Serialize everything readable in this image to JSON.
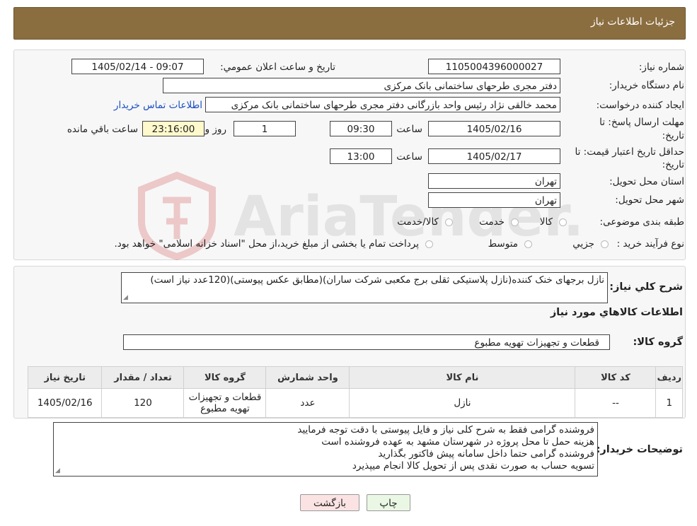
{
  "header": {
    "title": "جزئیات اطلاعات نیاز"
  },
  "labels": {
    "need_number": "شماره نیاز:",
    "announce_datetime": "تاریخ و ساعت اعلان عمومي:",
    "buyer_org": "نام دستگاه خریدار:",
    "requester": "ایجاد کننده درخواست:",
    "send_deadline_1": "مهلت ارسال پاسخ: تا",
    "send_deadline_2": "تاریخ:",
    "time_word": "ساعت",
    "day_and": "روز و",
    "remaining": "ساعت باقي مانده",
    "price_validity_1": "حداقل تاریخ اعتبار قیمت: تا",
    "price_validity_2": "تاریخ:",
    "province": "استان محل تحویل:",
    "city": "شهر محل تحویل:",
    "category": "طبقه بندی موضوعی:",
    "purchase_type": "نوع فرآیند خرید :",
    "general_desc": "شرح کلي نياز:",
    "goods_info": "اطلاعات کالاهاي مورد نياز",
    "goods_group": "گروه کالا:",
    "buyer_notes": "توضیحات خریدار:"
  },
  "values": {
    "need_number": "1105004396000027",
    "announce_datetime": "1405/02/14 - 09:07",
    "buyer_org": "دفتر مجری طرحهای ساختمانی بانک مرکزی",
    "requester": "محمد خالقی نژاد رئیس واحد بازرگانی دفتر مجری طرحهای ساختمانی بانک مرکزی",
    "contact_link": "اطلاعات تماس خریدار",
    "send_date": "1405/02/16",
    "send_time": "09:30",
    "days": "1",
    "remaining_time": "23:16:00",
    "validity_date": "1405/02/17",
    "validity_time": "13:00",
    "province": "تهران",
    "city": "تهران",
    "general_desc": "نازل برجهای خنک کننده(نازل پلاستیکی ثقلی برج مکعبی شرکت ساران)(مطابق عکس پیوستی)(120عدد نیاز است)",
    "goods_group": "قطعات و تجهیزات تهویه مطبوع"
  },
  "category_options": [
    "کالا",
    "خدمت",
    "کالا/خدمت"
  ],
  "purchase_options": [
    "جزیي",
    "متوسط"
  ],
  "purchase_note": "پرداخت تمام یا بخشی از مبلغ خرید،از محل \"اسناد خزانه اسلامی\" خواهد بود.",
  "table": {
    "headers": [
      "ردیف",
      "کد کالا",
      "نام کالا",
      "واحد شمارش",
      "گروه کالا",
      "تعداد / مقدار",
      "تاریخ نیاز"
    ],
    "rows": [
      [
        "1",
        "--",
        "نازل",
        "عدد",
        "قطعات و تجهیزات تهویه مطبوع",
        "120",
        "1405/02/16"
      ]
    ]
  },
  "buyer_notes": [
    "فروشنده گرامی فقط به شرح کلی نیاز و فایل پیوستی با دقت توجه فرمایید",
    "هزینه حمل تا محل پروژه در شهرستان مشهد به عهده فروشنده است",
    "فروشنده گرامی حتما داخل سامانه پیش فاکتور بگذارید",
    "تسویه حساب به صورت نقدی پس از تحویل کالا  انجام میپذیرد"
  ],
  "buttons": {
    "print": "چاپ",
    "back": "بازگشت"
  },
  "colors": {
    "header_bg": "#8b6e40",
    "link": "#1a4fc2",
    "print_bg": "#eaf7e4",
    "back_bg": "#fbe3e3"
  }
}
